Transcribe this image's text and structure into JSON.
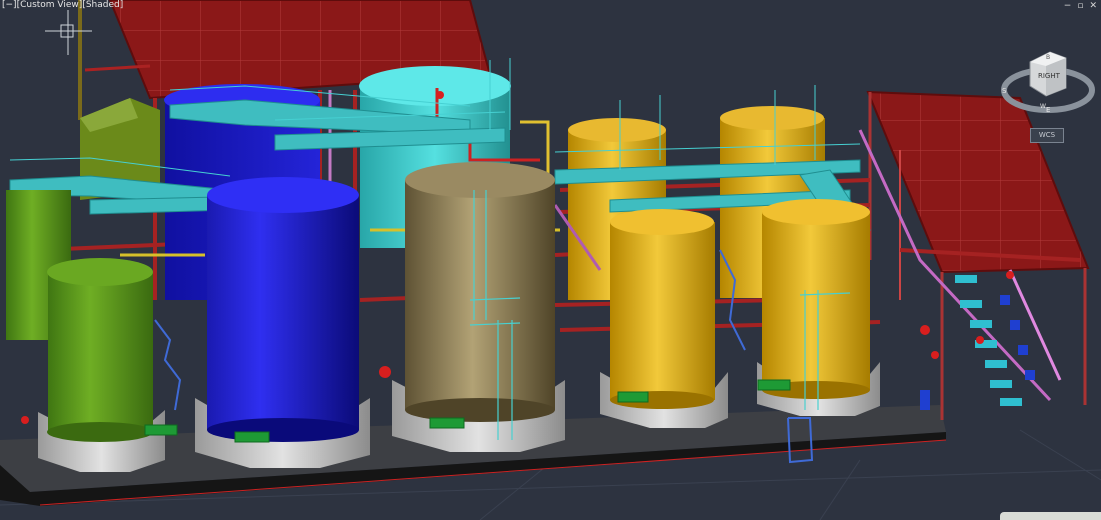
{
  "viewport": {
    "control_menu": "[−]",
    "view_menu": "[Custom View]",
    "style_menu": "[Shaded]",
    "window_controls": [
      "−",
      "▫",
      "✕"
    ]
  },
  "viewcube": {
    "face_label": "RIGHT",
    "top_face_label": "B",
    "compass": {
      "S": "S",
      "E": "E",
      "W": "W"
    },
    "ucs_menu": "WCS"
  },
  "icons": [
    "ucs-crosshair-icon",
    "viewcube-icon",
    "compass-ring-icon"
  ],
  "colors": {
    "background": "#2d3340",
    "roof_red": "#8b1a1a",
    "structure_red": "#9a2222",
    "platform_cyan": "#3fbdc0",
    "tank_green": "#5e9a1f",
    "tank_blue": "#1818c8",
    "tank_cyan": "#3ccfd0",
    "tank_khaki": "#8a7a52",
    "tank_yellow": "#e0b01a",
    "base_gray": "#b8b8b8",
    "slab_black": "#151515"
  }
}
